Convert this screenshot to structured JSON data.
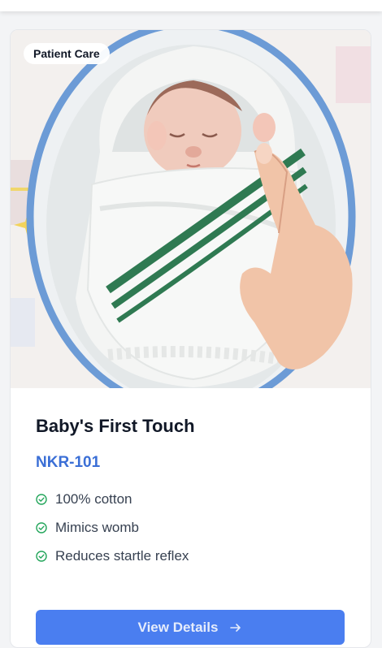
{
  "product": {
    "category_badge": "Patient Care",
    "title": "Baby's First Touch",
    "code": "NKR-101",
    "features": [
      {
        "text": "100% cotton",
        "icon": "check-circle-icon"
      },
      {
        "text": "Mimics womb",
        "icon": "check-circle-icon"
      },
      {
        "text": "Reduces startle reflex",
        "icon": "check-circle-icon"
      }
    ],
    "button_label": "View Details",
    "button_icon": "arrow-right-icon"
  },
  "colors": {
    "accent_blue": "#4a7ef0",
    "code_blue": "#3b6fd6",
    "check_green": "#22a55a",
    "title_text": "#111827"
  }
}
